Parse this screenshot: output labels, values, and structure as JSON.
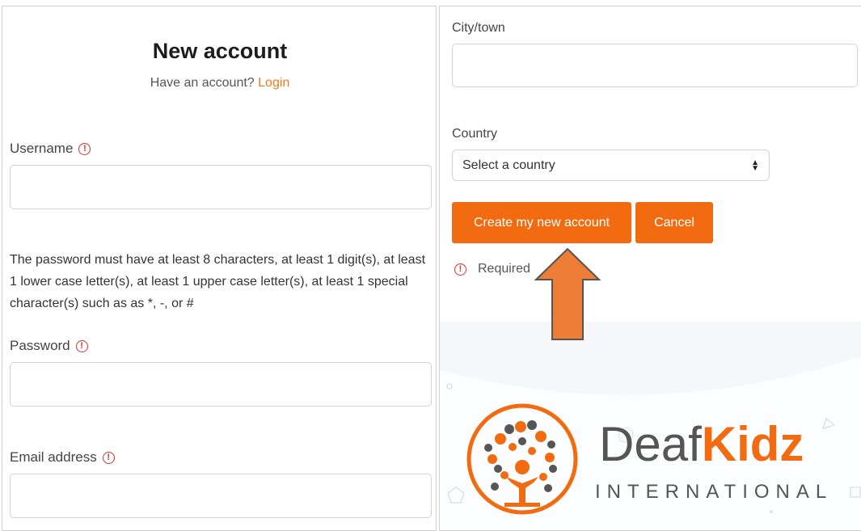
{
  "form": {
    "title": "New account",
    "have_account_text": "Have an account?",
    "login_link": "Login",
    "username_label": "Username",
    "password_help": "The password must have at least 8 characters, at least 1 digit(s), at least 1 lower case letter(s), at least 1 upper case letter(s), at least 1 special character(s) such as as *, -, or #",
    "password_label": "Password",
    "email_label": "Email address",
    "city_label": "City/town",
    "city_value": "",
    "country_label": "Country",
    "country_selected": "Select a country",
    "create_button": "Create my new account",
    "cancel_button": "Cancel",
    "required_note": "Required",
    "required_icon": "exclamation-circle-icon"
  },
  "branding": {
    "name_part1": "Deaf",
    "name_part2": "Kidz",
    "subtitle": "INTERNATIONAL"
  },
  "colors": {
    "accent": "#f26b10",
    "required": "#d1342a",
    "arrow": "#ee7d35"
  }
}
